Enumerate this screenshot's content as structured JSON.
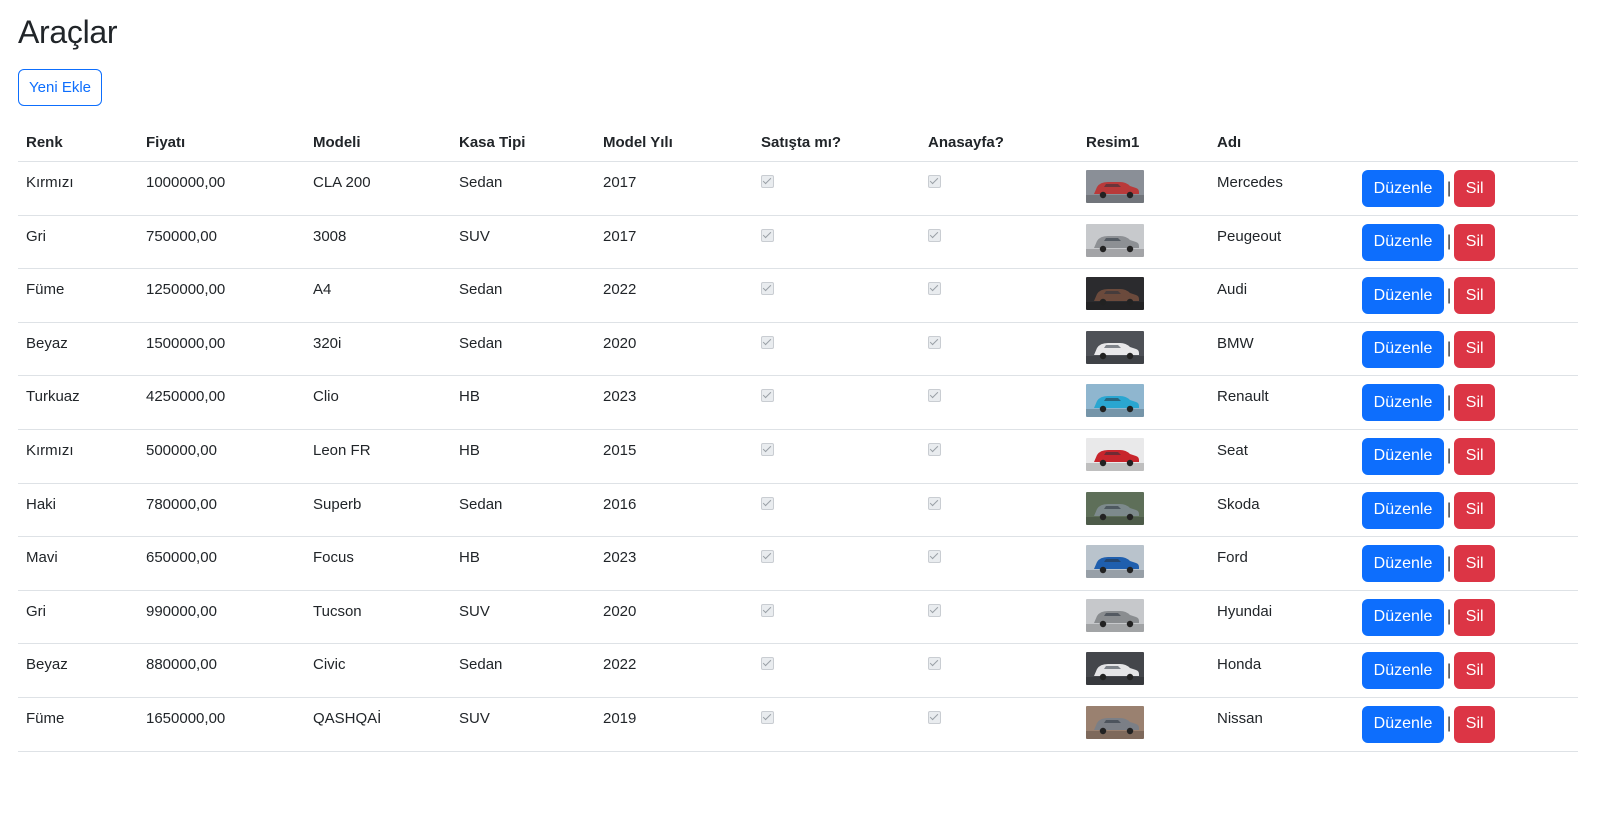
{
  "page": {
    "title": "Araçlar",
    "add_button": "Yeni Ekle"
  },
  "table": {
    "headers": [
      "Renk",
      "Fiyatı",
      "Modeli",
      "Kasa Tipi",
      "Model Yılı",
      "Satışta mı?",
      "Anasayfa?",
      "Resim1",
      "Adı",
      ""
    ],
    "edit_label": "Düzenle",
    "separator": "|",
    "delete_label": "Sil",
    "rows": [
      {
        "renk": "Kırmızı",
        "fiyat": "1000000,00",
        "model": "CLA 200",
        "kasa": "Sedan",
        "yil": "2017",
        "satista": true,
        "anasayfa": true,
        "adi": "Mercedes",
        "img_color": "#b93a3a",
        "img_bg": "#8a8f97"
      },
      {
        "renk": "Gri",
        "fiyat": "750000,00",
        "model": "3008",
        "kasa": "SUV",
        "yil": "2017",
        "satista": true,
        "anasayfa": true,
        "adi": "Peugeout",
        "img_color": "#8d9094",
        "img_bg": "#c7c9cc"
      },
      {
        "renk": "Füme",
        "fiyat": "1250000,00",
        "model": "A4",
        "kasa": "Sedan",
        "yil": "2022",
        "satista": true,
        "anasayfa": true,
        "adi": "Audi",
        "img_color": "#6b4a3c",
        "img_bg": "#2b2b2e"
      },
      {
        "renk": "Beyaz",
        "fiyat": "1500000,00",
        "model": "320i",
        "kasa": "Sedan",
        "yil": "2020",
        "satista": true,
        "anasayfa": true,
        "adi": "BMW",
        "img_color": "#e8e8ea",
        "img_bg": "#4e5157"
      },
      {
        "renk": "Turkuaz",
        "fiyat": "4250000,00",
        "model": "Clio",
        "kasa": "HB",
        "yil": "2023",
        "satista": true,
        "anasayfa": true,
        "adi": "Renault",
        "img_color": "#2aa6d1",
        "img_bg": "#8fb6cf"
      },
      {
        "renk": "Kırmızı",
        "fiyat": "500000,00",
        "model": "Leon FR",
        "kasa": "HB",
        "yil": "2015",
        "satista": true,
        "anasayfa": true,
        "adi": "Seat",
        "img_color": "#c8252c",
        "img_bg": "#e9e9ea"
      },
      {
        "renk": "Haki",
        "fiyat": "780000,00",
        "model": "Superb",
        "kasa": "Sedan",
        "yil": "2016",
        "satista": true,
        "anasayfa": true,
        "adi": "Skoda",
        "img_color": "#7d8a8c",
        "img_bg": "#5e6f59"
      },
      {
        "renk": "Mavi",
        "fiyat": "650000,00",
        "model": "Focus",
        "kasa": "HB",
        "yil": "2023",
        "satista": true,
        "anasayfa": true,
        "adi": "Ford",
        "img_color": "#1f5fae",
        "img_bg": "#b9c3cc"
      },
      {
        "renk": "Gri",
        "fiyat": "990000,00",
        "model": "Tucson",
        "kasa": "SUV",
        "yil": "2020",
        "satista": true,
        "anasayfa": true,
        "adi": "Hyundai",
        "img_color": "#8a8d90",
        "img_bg": "#c6c8cb"
      },
      {
        "renk": "Beyaz",
        "fiyat": "880000,00",
        "model": "Civic",
        "kasa": "Sedan",
        "yil": "2022",
        "satista": true,
        "anasayfa": true,
        "adi": "Honda",
        "img_color": "#e4e4e6",
        "img_bg": "#44464b"
      },
      {
        "renk": "Füme",
        "fiyat": "1650000,00",
        "model": "QASHQAİ",
        "kasa": "SUV",
        "yil": "2019",
        "satista": true,
        "anasayfa": true,
        "adi": "Nissan",
        "img_color": "#7b7f86",
        "img_bg": "#9a8170"
      }
    ]
  }
}
